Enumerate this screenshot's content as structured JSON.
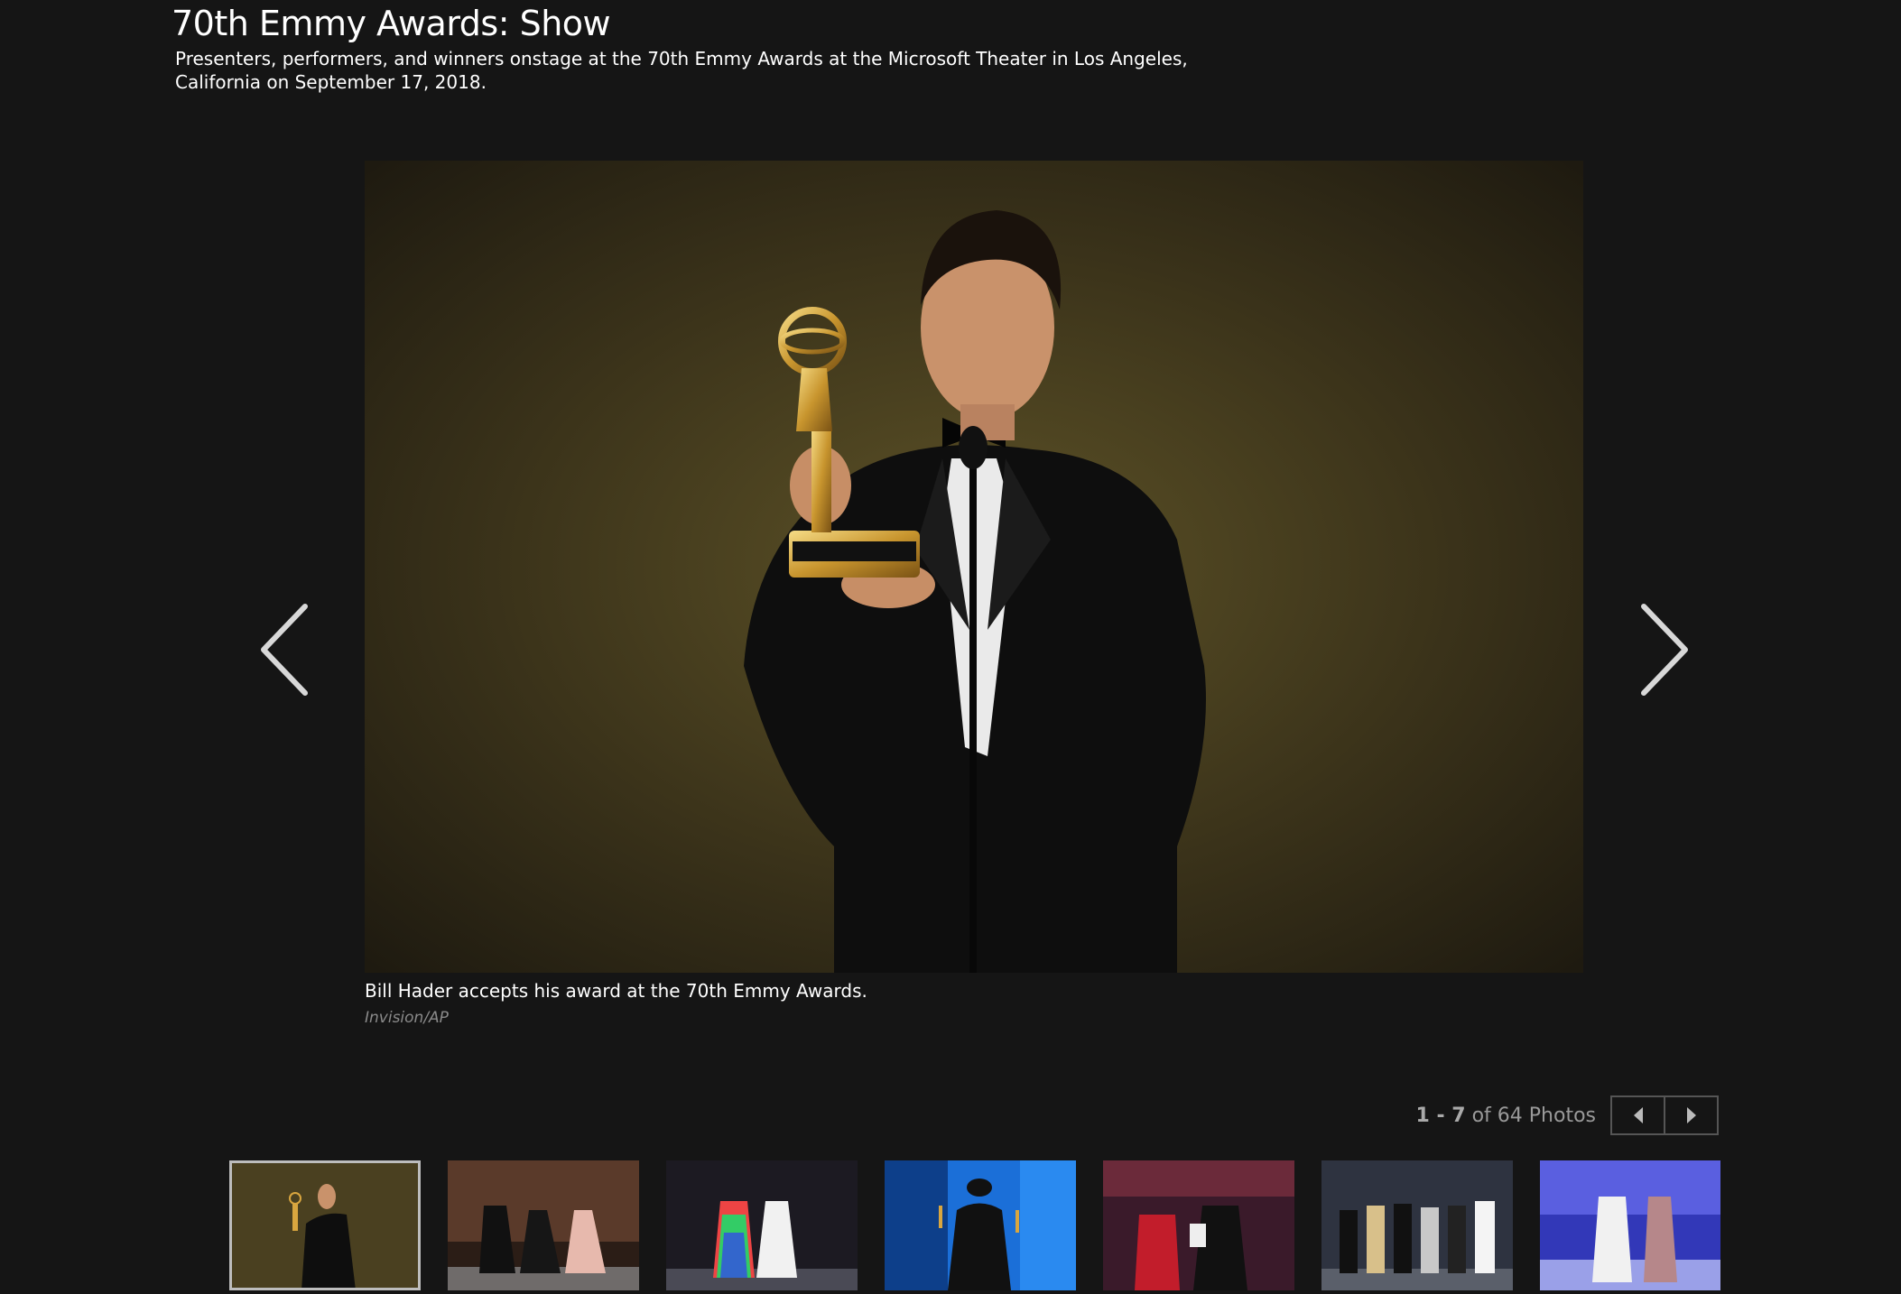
{
  "gallery": {
    "title": "70th Emmy Awards: Show",
    "description": "Presenters, performers, and winners onstage at the 70th Emmy Awards at the Microsoft Theater in Los Angeles, California on September 17, 2018."
  },
  "photo": {
    "caption": "Bill Hader accepts his award at the 70th Emmy Awards.",
    "credit": "Invision/AP"
  },
  "pager": {
    "range_start": "1",
    "range_sep": " - ",
    "range_end": "7",
    "of_label": " of 64 Photos"
  },
  "icons": {
    "prev": "chevron-left-icon",
    "next": "chevron-right-icon",
    "pager_prev": "triangle-left-icon",
    "pager_next": "triangle-right-icon"
  },
  "colors": {
    "background": "#151515",
    "text": "#ffffff",
    "muted": "#8a8a8a",
    "active_thumb_border": "#bdbdbd"
  }
}
